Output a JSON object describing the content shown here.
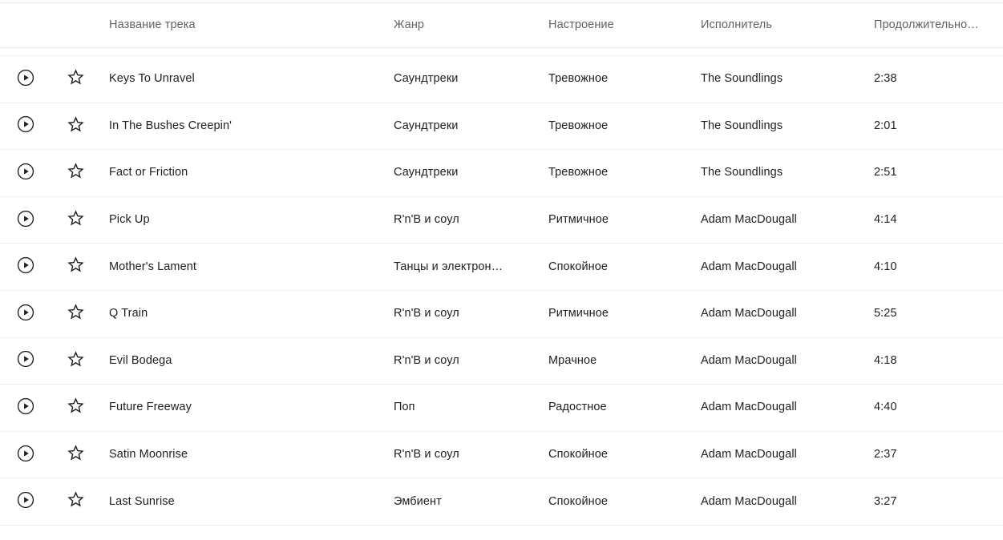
{
  "table": {
    "columns": [
      {
        "key": "play",
        "label": ""
      },
      {
        "key": "favorite",
        "label": ""
      },
      {
        "key": "title",
        "label": "Название трека"
      },
      {
        "key": "genre",
        "label": "Жанр"
      },
      {
        "key": "mood",
        "label": "Настроение"
      },
      {
        "key": "artist",
        "label": "Исполнитель"
      },
      {
        "key": "duration",
        "label": "Продолжительно…"
      }
    ],
    "icons": {
      "play": "play-circle-icon",
      "favorite": "star-outline-icon"
    },
    "rows": [
      {
        "title": "Keys To Unravel",
        "genre": "Саундтреки",
        "mood": "Тревожное",
        "artist": "The Soundlings",
        "duration": "2:38"
      },
      {
        "title": "In The Bushes Creepin'",
        "genre": "Саундтреки",
        "mood": "Тревожное",
        "artist": "The Soundlings",
        "duration": "2:01"
      },
      {
        "title": "Fact or Friction",
        "genre": "Саундтреки",
        "mood": "Тревожное",
        "artist": "The Soundlings",
        "duration": "2:51"
      },
      {
        "title": "Pick Up",
        "genre": "R'n'B и соул",
        "mood": "Ритмичное",
        "artist": "Adam MacDougall",
        "duration": "4:14"
      },
      {
        "title": "Mother's Lament",
        "genre": "Танцы и электрон…",
        "mood": "Спокойное",
        "artist": "Adam MacDougall",
        "duration": "4:10"
      },
      {
        "title": "Q Train",
        "genre": "R'n'B и соул",
        "mood": "Ритмичное",
        "artist": "Adam MacDougall",
        "duration": "5:25"
      },
      {
        "title": "Evil Bodega",
        "genre": "R'n'B и соул",
        "mood": "Мрачное",
        "artist": "Adam MacDougall",
        "duration": "4:18"
      },
      {
        "title": "Future Freeway",
        "genre": "Поп",
        "mood": "Радостное",
        "artist": "Adam MacDougall",
        "duration": "4:40"
      },
      {
        "title": "Satin Moonrise",
        "genre": "R'n'B и соул",
        "mood": "Спокойное",
        "artist": "Adam MacDougall",
        "duration": "2:37"
      },
      {
        "title": "Last Sunrise",
        "genre": "Эмбиент",
        "mood": "Спокойное",
        "artist": "Adam MacDougall",
        "duration": "3:27"
      }
    ]
  },
  "colors": {
    "background": "#ffffff",
    "header_text": "#5f6368",
    "body_text": "#202124",
    "divider": "#eceff1",
    "icon": "#202124"
  }
}
